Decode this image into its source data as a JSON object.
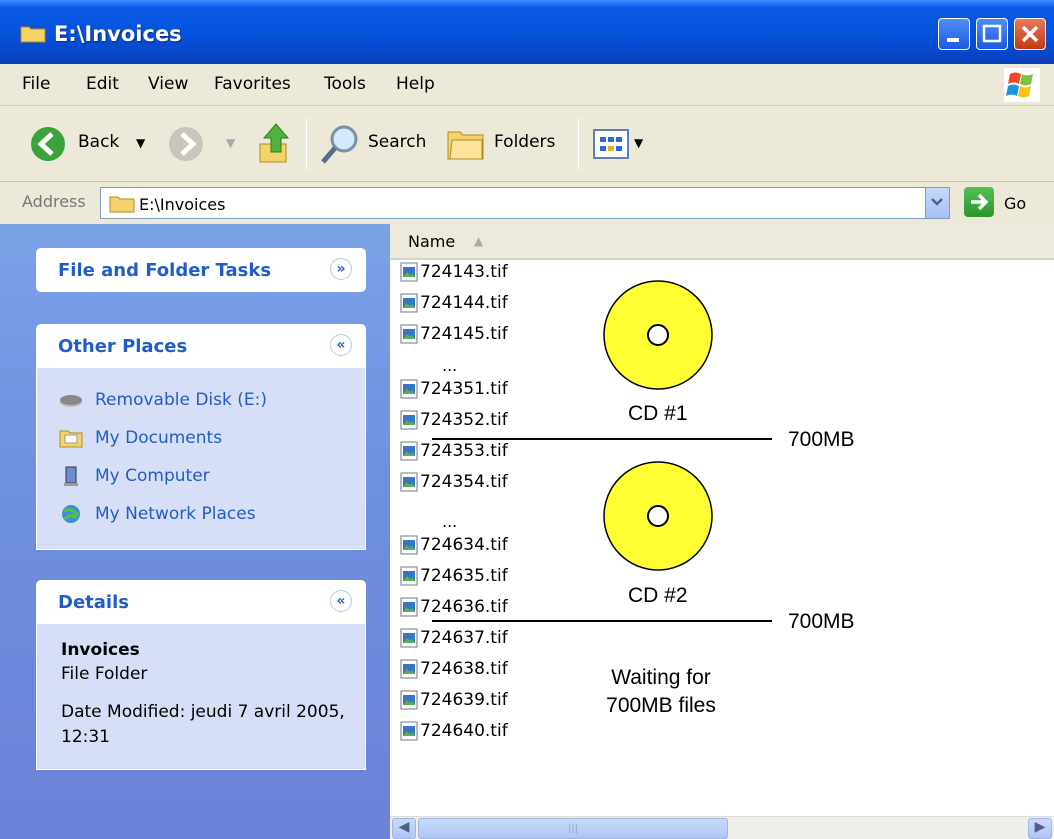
{
  "window": {
    "title": "E:\\Invoices"
  },
  "menu": [
    "File",
    "Edit",
    "View",
    "Favorites",
    "Tools",
    "Help"
  ],
  "toolbar": {
    "back": "Back",
    "search": "Search",
    "folders": "Folders"
  },
  "address": {
    "label": "Address",
    "value": "E:\\Invoices",
    "go": "Go"
  },
  "tasks": {
    "file_folder_tasks": "File and Folder Tasks",
    "other_places": {
      "title": "Other Places",
      "items": [
        "Removable Disk (E:)",
        "My Documents",
        "My Computer",
        "My Network Places"
      ]
    },
    "details": {
      "title": "Details",
      "name": "Invoices",
      "type": "File Folder",
      "date": "Date Modified: jeudi 7 avril 2005, 12:31"
    }
  },
  "list": {
    "column": "Name",
    "files_a": [
      "724143.tif",
      "724144.tif",
      "724145.tif"
    ],
    "ellipsis": "...",
    "files_b": [
      "724351.tif",
      "724352.tif",
      "724353.tif",
      "724354.tif"
    ],
    "files_c": [
      "724634.tif",
      "724635.tif",
      "724636.tif",
      "724637.tif",
      "724638.tif",
      "724639.tif",
      "724640.tif"
    ]
  },
  "annotations": {
    "cd1": "CD #1",
    "cd2": "CD #2",
    "size1": "700MB",
    "size2": "700MB",
    "waiting_line1": "Waiting for",
    "waiting_line2": "700MB files"
  },
  "colors": {
    "disc": "#ffff33",
    "titlebar": "#0553dc",
    "link": "#215dc6"
  }
}
